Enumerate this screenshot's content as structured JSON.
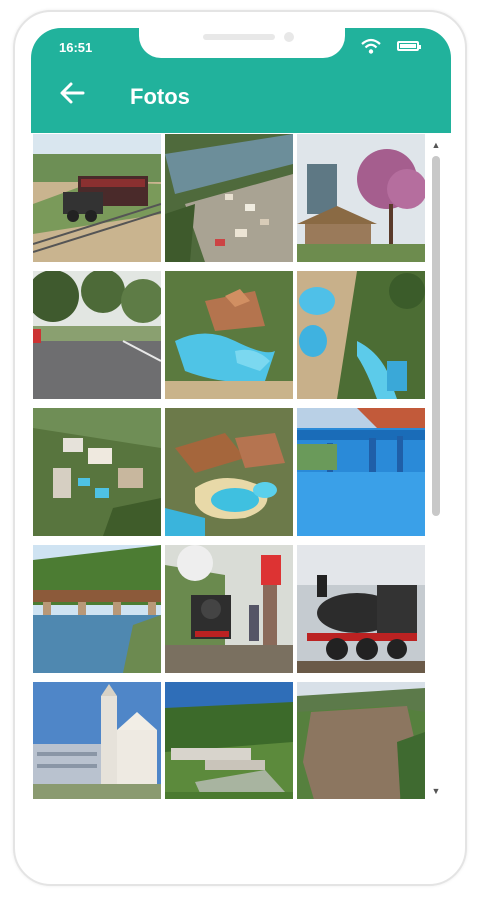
{
  "status_bar": {
    "time": "16:51"
  },
  "header": {
    "title": "Fotos",
    "back_icon": "arrow-left-icon",
    "color": "#21b29c"
  },
  "photos": [
    "train-on-tracks",
    "aerial-river-town",
    "gazebo-pink-tree",
    "tree-lined-road",
    "aerial-water-park",
    "aerial-water-park-2",
    "aerial-hillside-resort",
    "aerial-pool-complex",
    "blue-pool-pergola",
    "railway-bridge-river",
    "steam-train-station",
    "steam-locomotive",
    "church-buildings",
    "aerial-green-field",
    "river-valley"
  ],
  "scrollbar": {
    "position": 0.0
  }
}
